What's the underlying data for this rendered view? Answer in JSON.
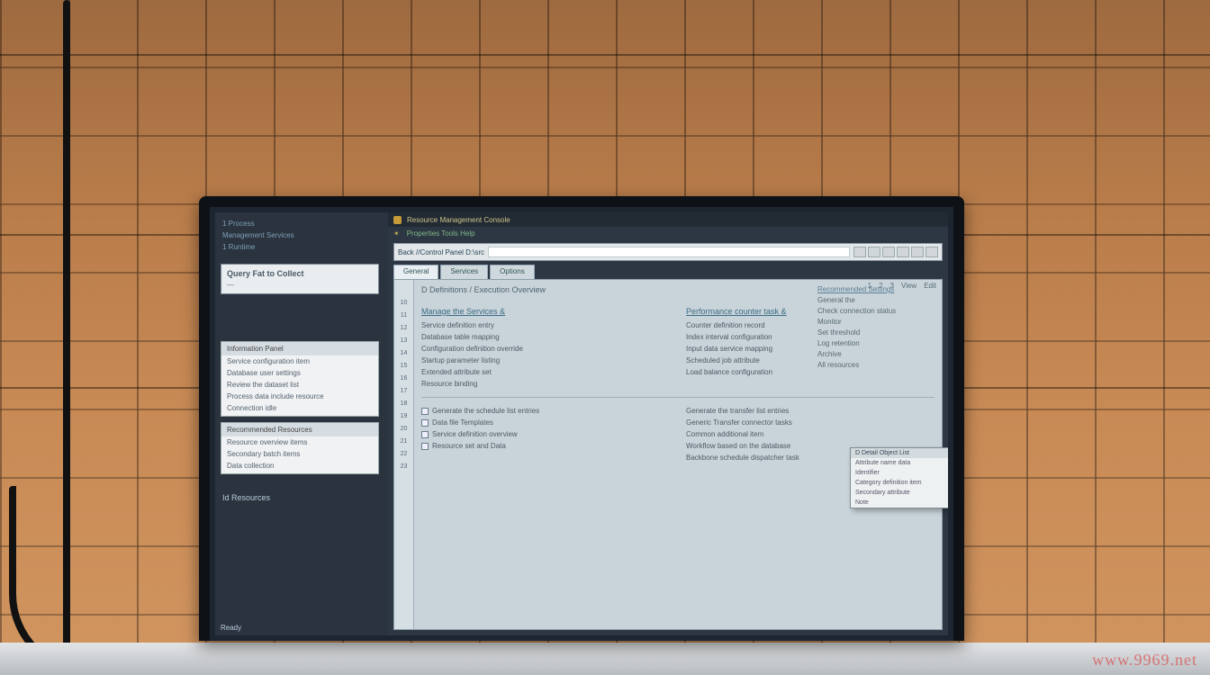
{
  "watermark": "www.9969.net",
  "leftpane": {
    "top_lines": [
      "1  Process",
      "Management Services",
      "1  Runtime"
    ],
    "box": {
      "title": "Query  Fat to Collect",
      "subtitle": "—"
    },
    "card1": {
      "title": "Information Panel",
      "rows": [
        "Service configuration item",
        "Database user settings",
        "Review the dataset list",
        "Process  data include resource",
        "Connection idle"
      ]
    },
    "card2": {
      "title": "Recommended Resources",
      "rows": [
        "Resource overview items",
        "Secondary batch items",
        "Data  collection"
      ]
    },
    "footer_label": "Id  Resources",
    "status": "Ready"
  },
  "mainpane": {
    "window_title": "Resource Management Console",
    "menu_items": [
      "Properties  Tools  Help"
    ],
    "address_label": "Back  //Control Panel  D:\\src",
    "tabs": [
      "General",
      "Services",
      "Options"
    ],
    "toolbar_buttons": [
      "1",
      "2",
      "3",
      "View",
      "Edit"
    ],
    "page_title": "D  Definitions / Execution   Overview",
    "right_panel": {
      "title": "Recommended Settings",
      "rows": [
        "General  the",
        "Check  connection status",
        "Monitor",
        "Set  threshold",
        "Log retention",
        "Archive",
        "All resources"
      ]
    },
    "left_section": {
      "heading": "Manage the Services &",
      "rows": [
        "Service definition entry",
        "Database table mapping",
        "Configuration definition override",
        "Startup parameter listing",
        "Extended attribute set",
        "Resource binding"
      ]
    },
    "mid_section": {
      "heading": "Performance counter task &",
      "rows": [
        "Counter definition record",
        "Index interval configuration",
        "Input  data service mapping",
        "Scheduled  job  attribute",
        "Load  balance  configuration"
      ]
    },
    "lower_left": {
      "rows": [
        "Generate  the  schedule  list  entries",
        "Data file  Templates",
        "Service  definition  overview",
        "Resource  set  and   Data"
      ]
    },
    "lower_mid": {
      "rows": [
        "Generate  the  transfer list  entries",
        "Generic  Transfer connector  tasks",
        "Common  additional  item",
        "Workflow  based  on  the  database",
        "Backbone  schedule  dispatcher  task"
      ]
    },
    "popup": {
      "title": "D Detail Object  List",
      "rows": [
        "Attribute name data",
        "Identifier",
        "Category definition item",
        "Secondary  attribute",
        "Note"
      ]
    },
    "line_numbers": [
      "10",
      "11",
      "12",
      "13",
      "14",
      "15",
      "16",
      "17",
      "18",
      "19",
      "20",
      "21",
      "22",
      "23"
    ]
  }
}
